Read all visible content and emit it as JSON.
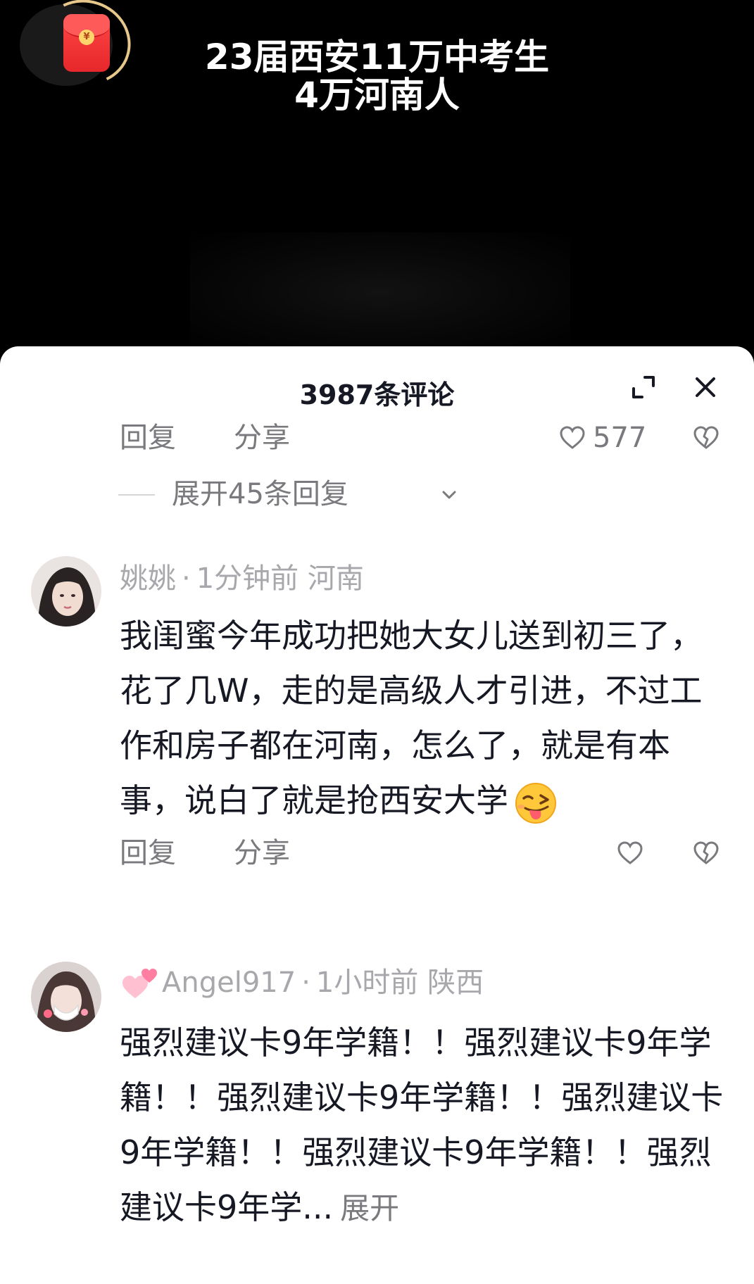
{
  "video": {
    "title_line1": "23届西安11万中考生",
    "title_line2": "4万河南人",
    "redpacket_symbol": "¥"
  },
  "sheet": {
    "title": "3987条评论",
    "top_actions": {
      "reply": "回复",
      "share": "分享",
      "likes": "577"
    },
    "expand_replies": "展开45条回复"
  },
  "comments": [
    {
      "username": "姚姚",
      "separator": "·",
      "time": "1分钟前",
      "location": "河南",
      "text": "我闺蜜今年成功把她大女儿送到初三了，花了几W，走的是高级人才引进，不过工作和房子都在河南，怎么了，就是有本事，说白了就是抢西安大学",
      "emoji": "wink-tongue-emoji",
      "reply": "回复",
      "share": "分享"
    },
    {
      "username": "Angel917",
      "separator": "·",
      "time": "1小时前",
      "location": "陕西",
      "text": "强烈建议卡9年学籍！！强烈建议卡9年学籍！！强烈建议卡9年学籍！！强烈建议卡9年学籍！！强烈建议卡9年学籍！！强烈建议卡9年学...",
      "more": "展开"
    }
  ],
  "colors": {
    "sheet_bg": "#ffffff",
    "text_primary": "#161823",
    "text_secondary": "#7a7a7e",
    "text_meta": "#a8a8ac",
    "redpacket": "#e6272b"
  }
}
